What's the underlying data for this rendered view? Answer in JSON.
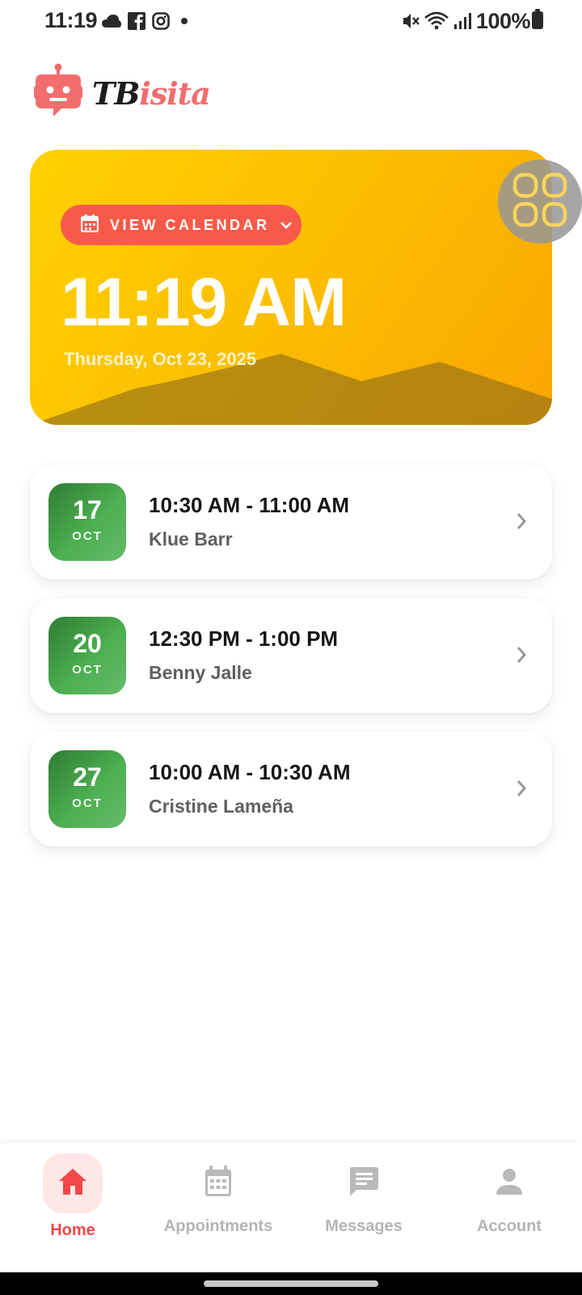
{
  "status_bar": {
    "time": "11:19",
    "battery": "100%",
    "icons_left": [
      "cloud-icon",
      "facebook-icon",
      "instagram-icon",
      "notification-dot"
    ],
    "icons_right": [
      "mute-icon",
      "wifi-icon",
      "signal-icon",
      "battery-icon"
    ]
  },
  "app": {
    "logo_prefix": "TB",
    "logo_suffix": "isita",
    "brand_color": "#f26d6d",
    "accent_color": "#f04848"
  },
  "hero": {
    "button_label": "VIEW CALENDAR",
    "time": "11:19 AM",
    "date": "Thursday, Oct 23, 2025",
    "gradient": [
      "#fed200",
      "#f9a600"
    ]
  },
  "appointments": [
    {
      "day": "17",
      "month": "OCT",
      "time": "10:30 AM - 11:00 AM",
      "name": "Klue Barr"
    },
    {
      "day": "20",
      "month": "OCT",
      "time": "12:30 PM - 1:00 PM",
      "name": "Benny Jalle"
    },
    {
      "day": "27",
      "month": "OCT",
      "time": "10:00 AM - 10:30 AM",
      "name": "Cristine Lameña"
    }
  ],
  "nav": {
    "items": [
      {
        "label": "Home",
        "icon": "home-icon",
        "active": true
      },
      {
        "label": "Appointments",
        "icon": "calendar-icon",
        "active": false
      },
      {
        "label": "Messages",
        "icon": "message-icon",
        "active": false
      },
      {
        "label": "Account",
        "icon": "person-icon",
        "active": false
      }
    ]
  }
}
